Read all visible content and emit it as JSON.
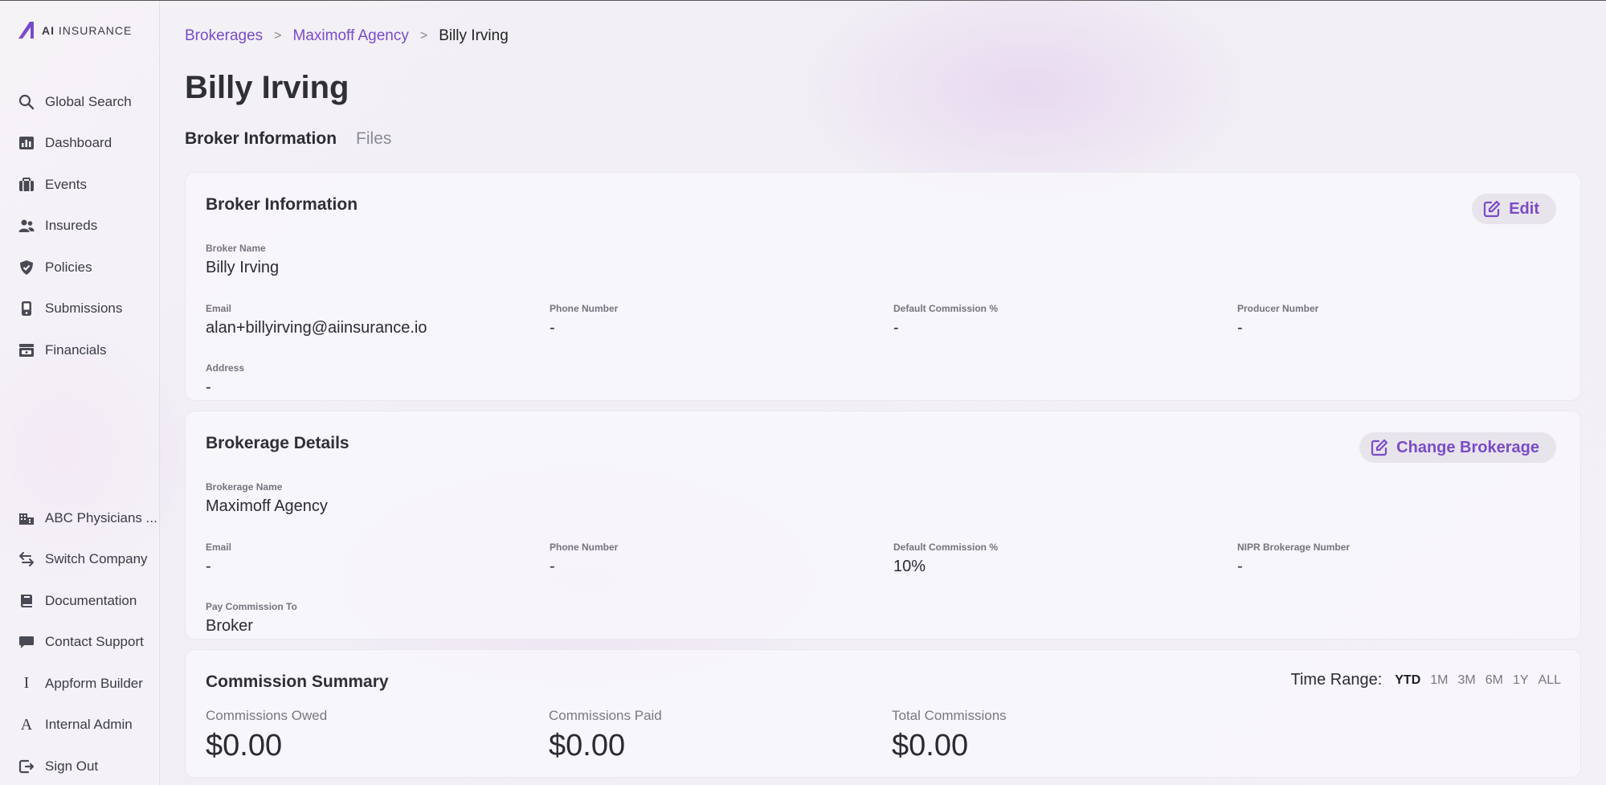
{
  "app": {
    "logo_text_bold": "AI",
    "logo_text": "INSURANCE"
  },
  "sidebar": {
    "top_items": [
      {
        "label": "Global Search",
        "icon": "search-icon"
      },
      {
        "label": "Dashboard",
        "icon": "chart-icon"
      },
      {
        "label": "Events",
        "icon": "briefcase-icon"
      },
      {
        "label": "Insureds",
        "icon": "users-icon"
      },
      {
        "label": "Policies",
        "icon": "shield-icon"
      },
      {
        "label": "Submissions",
        "icon": "phone-icon"
      },
      {
        "label": "Financials",
        "icon": "register-icon"
      }
    ],
    "bottom_items": [
      {
        "label": "ABC Physicians ...",
        "icon": "building-icon"
      },
      {
        "label": "Switch Company",
        "icon": "switch-icon"
      },
      {
        "label": "Documentation",
        "icon": "book-icon"
      },
      {
        "label": "Contact Support",
        "icon": "chat-icon"
      },
      {
        "label": "Appform Builder",
        "icon": "letter-i-icon",
        "glyph": "I"
      },
      {
        "label": "Internal Admin",
        "icon": "letter-a-icon",
        "glyph": "A"
      },
      {
        "label": "Sign Out",
        "icon": "sign-out-icon"
      }
    ]
  },
  "breadcrumb": {
    "level1": "Brokerages",
    "level2": "Maximoff Agency",
    "current": "Billy Irving",
    "separator": ">"
  },
  "page_title": "Billy Irving",
  "tabs": [
    {
      "label": "Broker Information",
      "active": true
    },
    {
      "label": "Files",
      "active": false
    }
  ],
  "broker_info": {
    "title": "Broker Information",
    "edit_label": "Edit",
    "broker_name_label": "Broker Name",
    "broker_name": "Billy Irving",
    "email_label": "Email",
    "email": "alan+billyirving@aiinsurance.io",
    "phone_label": "Phone Number",
    "phone": "-",
    "commission_label": "Default Commission %",
    "commission": "-",
    "producer_label": "Producer Number",
    "producer": "-",
    "address_label": "Address",
    "address": "-"
  },
  "brokerage": {
    "title": "Brokerage Details",
    "change_label": "Change Brokerage",
    "name_label": "Brokerage Name",
    "name": "Maximoff Agency",
    "email_label": "Email",
    "email": "-",
    "phone_label": "Phone Number",
    "phone": "-",
    "commission_label": "Default Commission %",
    "commission": "10%",
    "nipr_label": "NIPR Brokerage Number",
    "nipr": "-",
    "pay_label": "Pay Commission To",
    "pay": "Broker"
  },
  "commission_summary": {
    "title": "Commission Summary",
    "time_range_label": "Time Range:",
    "time_options": [
      "YTD",
      "1M",
      "3M",
      "6M",
      "1Y",
      "ALL"
    ],
    "selected_option": "YTD",
    "owed_label": "Commissions Owed",
    "owed": "$0.00",
    "paid_label": "Commissions Paid",
    "paid": "$0.00",
    "total_label": "Total Commissions",
    "total": "$0.00"
  },
  "colors": {
    "accent": "#7a4bc9",
    "text": "#2b2b33",
    "muted": "#7a7782"
  }
}
